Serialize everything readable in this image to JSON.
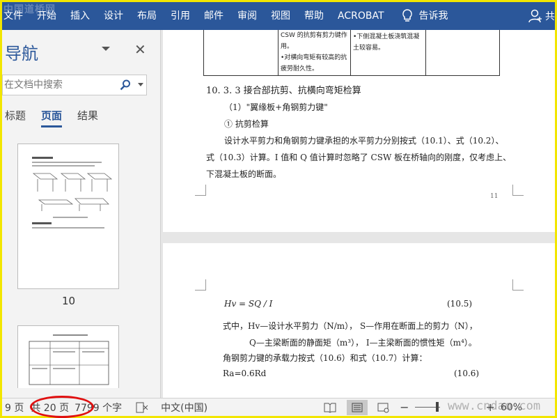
{
  "watermark_top": "中国道桥网",
  "watermark_bottom": "www.cndao.com",
  "ribbon": {
    "tabs": [
      "文件",
      "开始",
      "插入",
      "设计",
      "布局",
      "引用",
      "邮件",
      "审阅",
      "视图",
      "帮助",
      "ACROBAT"
    ],
    "tell_me": "告诉我",
    "share": "共"
  },
  "navigation": {
    "title": "导航",
    "search_placeholder": "在文档中搜索",
    "tabs": [
      "标题",
      "页面",
      "结果"
    ],
    "active_tab": "页面",
    "thumb1_label": "10"
  },
  "document": {
    "table_cells": {
      "c1_l1": "CSW 的抗剪有剪力键作",
      "c1_l2": "用。",
      "c1_l3": "•对横向弯矩有较高的抗",
      "c1_l4": "疲劳耐久性。",
      "c2_l1": "•下侧混凝土板浇筑混凝",
      "c2_l2": "土较容易。"
    },
    "heading": "10. 3. 3  接合部抗剪、抗横向弯矩检算",
    "sub1": "（1）\"翼缘板+角钢剪力键\"",
    "sub2": "①  抗剪检算",
    "para1": "设计水平剪力和角钢剪力键承担的水平剪力分别按式（10.1）、式（10.2）、",
    "para2": "式（10.3）计算。I 值和 Q 值计算时忽略了 CSW 板在桥轴向的刚度，仅考虑上、",
    "para3": "下混凝土板的断面。",
    "page_number": "11",
    "formula1": "Hv = SQ / I",
    "formula1_no": "(10.5)",
    "def1": "式中，Hv—设计水平剪力（N/m），   S—作用在断面上的剪力（N），",
    "def2": "Q—主梁断面的静面矩（m³），    I—主梁断面的惯性矩（m⁴）。",
    "para4": "角钢剪力键的承载力按式（10.6）和式（10.7）计算：",
    "formula2": "Ra=0.6Rd",
    "formula2_no": "(10.6)"
  },
  "status": {
    "page": "9 页",
    "total": "共 20 页",
    "words": "7799 个字",
    "language": "中文(中国)",
    "zoom": "60%"
  }
}
